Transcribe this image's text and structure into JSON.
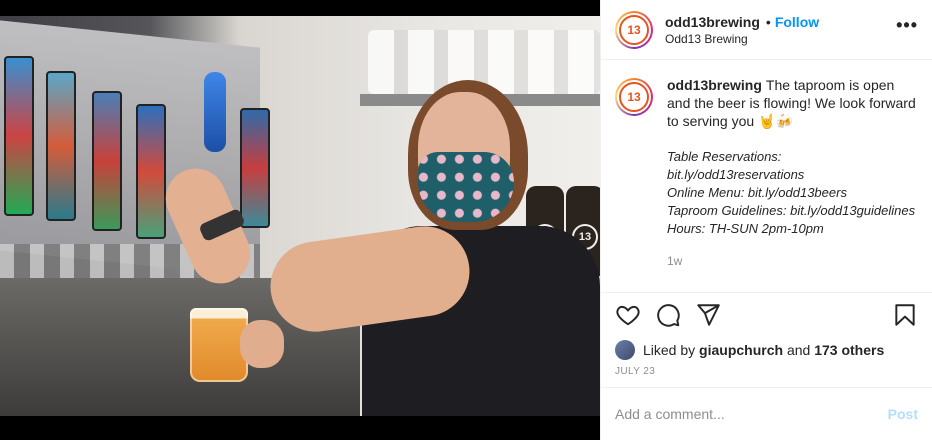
{
  "post": {
    "username": "odd13brewing",
    "follow_label": "Follow",
    "location": "Odd13 Brewing",
    "more_icon": "more-options-icon",
    "logo_text": "13"
  },
  "caption": {
    "username": "odd13brewing",
    "text": "The taproom is open and the beer is flowing! We look forward to serving you 🤘🍻",
    "lines": [
      "Table Reservations: bit.ly/odd13reservations",
      "Online Menu: bit.ly/odd13beers",
      "Taproom Guidelines: bit.ly/odd13guidelines",
      "Hours: TH-SUN 2pm-10pm"
    ],
    "time": "1w"
  },
  "likes": {
    "prefix": "Liked by",
    "user": "giaupchurch",
    "and": "and",
    "others": "173 others"
  },
  "date": "JULY 23",
  "comment": {
    "placeholder": "Add a comment...",
    "post_label": "Post"
  },
  "icons": [
    "heart-icon",
    "comment-icon",
    "share-icon",
    "bookmark-icon"
  ],
  "colors": {
    "accent": "#0095f6",
    "post_disabled": "#b2dffc",
    "meta": "#8e8e8e"
  }
}
